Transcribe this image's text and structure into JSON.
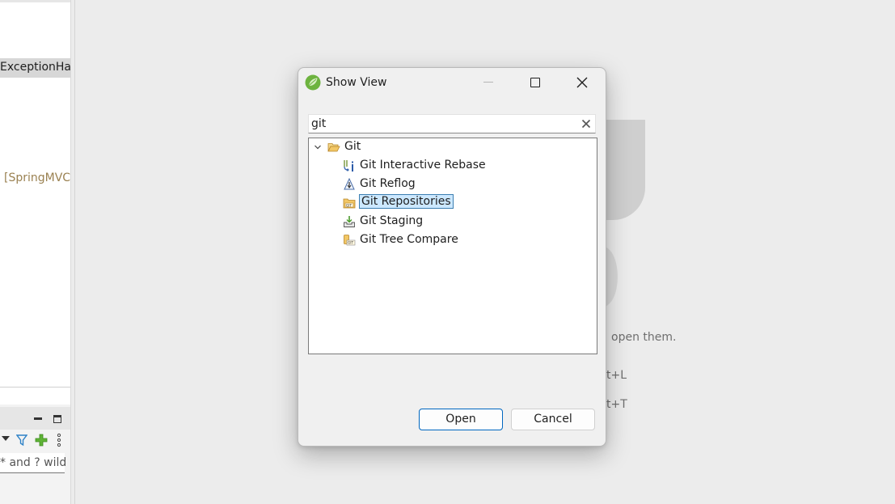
{
  "background": {
    "left_panel": {
      "selected_row_text": "ExceptionHar",
      "project_text": "[SpringMVC",
      "filter_text": "* and ? wild"
    },
    "editor_hints": {
      "line1": "open them.",
      "line2": "t+L",
      "line3": "t+T"
    }
  },
  "dialog": {
    "title": "Show View",
    "search": {
      "value": "git"
    },
    "tree": {
      "root": {
        "label": "Git",
        "icon": "open-folder-icon",
        "expanded": true
      },
      "children": [
        {
          "label": "Git Interactive Rebase",
          "icon": "rebase-icon"
        },
        {
          "label": "Git Reflog",
          "icon": "reflog-icon"
        },
        {
          "label": "Git Repositories",
          "icon": "git-repository-icon",
          "selected": true
        },
        {
          "label": "Git Staging",
          "icon": "staging-icon"
        },
        {
          "label": "Git Tree Compare",
          "icon": "tree-compare-icon"
        }
      ]
    },
    "buttons": {
      "open": "Open",
      "cancel": "Cancel"
    }
  },
  "colors": {
    "selection": "#cce8ff",
    "default_button_border": "#0067c0",
    "folder": "#e8a93a"
  }
}
